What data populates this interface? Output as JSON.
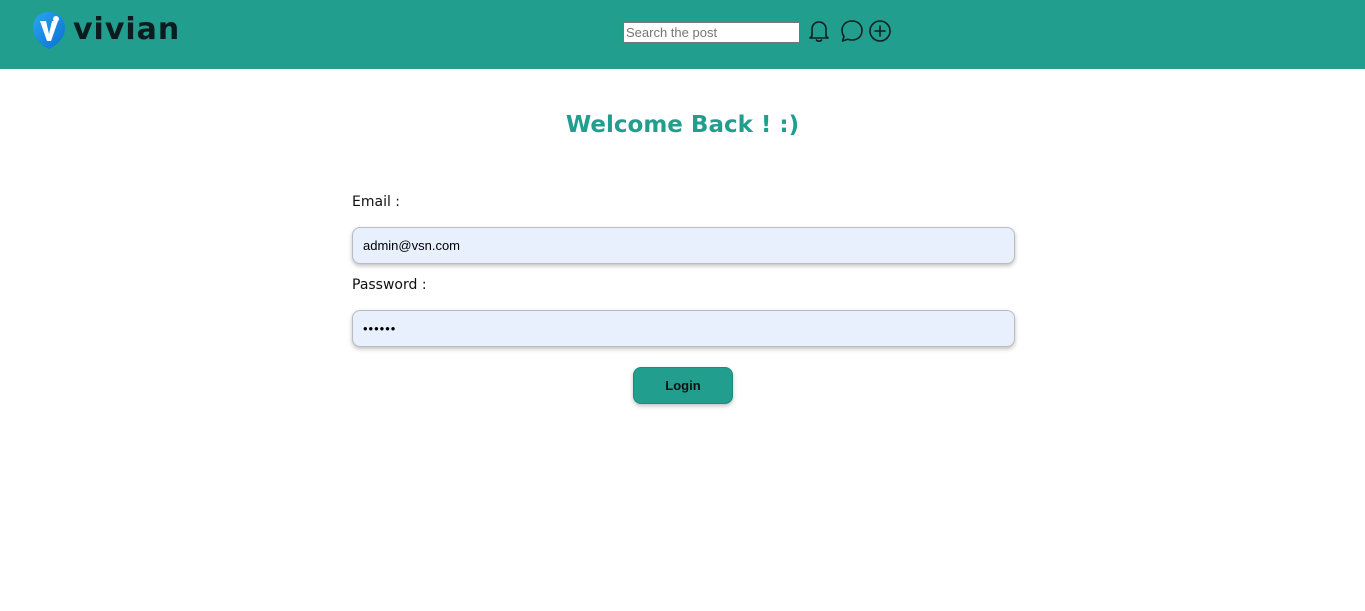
{
  "header": {
    "brand": "vivian",
    "search": {
      "placeholder": "Search the post",
      "value": ""
    },
    "icons": [
      "bell-icon",
      "chat-icon",
      "plus-circle-icon"
    ]
  },
  "login": {
    "title": "Welcome Back ! :)",
    "email_label": "Email :",
    "email_value": "admin@vsn.com",
    "password_label": "Password :",
    "password_value": "••••••",
    "submit_label": "Login"
  },
  "colors": {
    "accent": "#219e8e",
    "input_bg": "#e8f0fe",
    "logo_blue": "#1b8fe8",
    "logo_text": "#0d1b1f"
  }
}
